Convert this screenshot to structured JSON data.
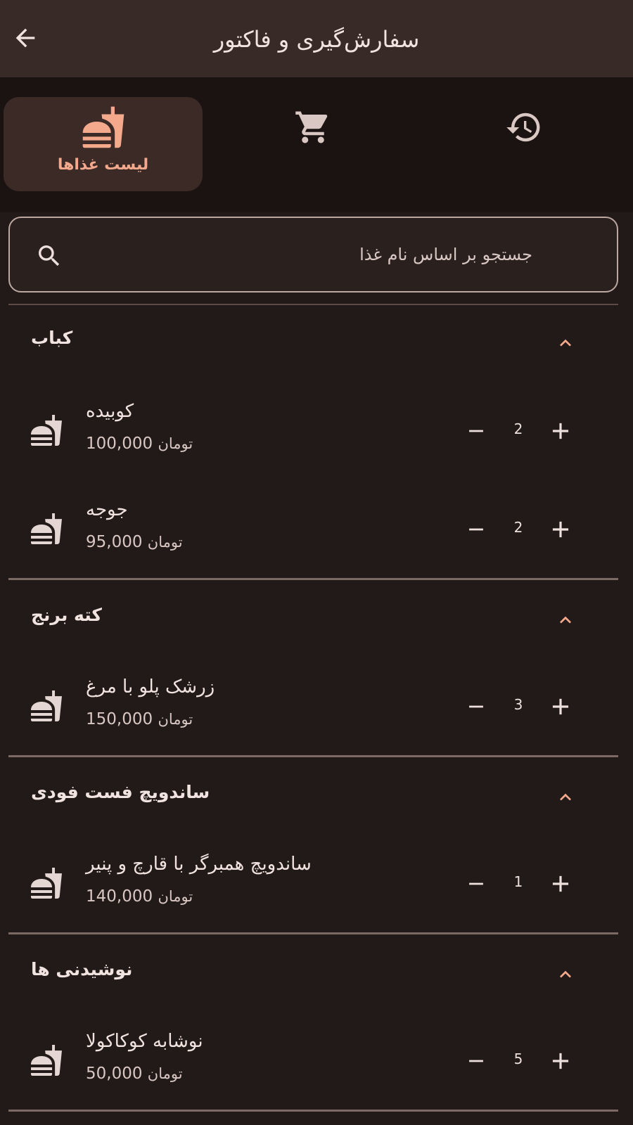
{
  "appbar": {
    "title": "سفارش‌گیری و فاکتور",
    "back_icon": "arrow-back-icon"
  },
  "nav": {
    "items": [
      {
        "label": "لیست غذاها",
        "icon": "fastfood-icon",
        "active": true
      },
      {
        "label": "",
        "icon": "cart-icon",
        "active": false
      },
      {
        "label": "",
        "icon": "history-icon",
        "active": false
      }
    ]
  },
  "search": {
    "placeholder": "جستجو بر اساس نام غذا",
    "value": ""
  },
  "currency": "تومان",
  "colors": {
    "accent": "#f4a98d",
    "background": "#221a18",
    "appbar": "#382a27"
  },
  "sections": [
    {
      "title": "کباب",
      "items": [
        {
          "name": "کوبیده",
          "price": "100,000",
          "qty": "2"
        },
        {
          "name": "جوجه",
          "price": "95,000",
          "qty": "2"
        }
      ]
    },
    {
      "title": "کته برنج",
      "items": [
        {
          "name": "زرشک پلو با مرغ",
          "price": "150,000",
          "qty": "3"
        }
      ]
    },
    {
      "title": "ساندویچ فست فودی",
      "items": [
        {
          "name": "ساندویچ همبرگر با قارچ و پنیر",
          "price": "140,000",
          "qty": "1"
        }
      ]
    },
    {
      "title": "نوشیدنی ها",
      "items": [
        {
          "name": "نوشابه کوکاکولا",
          "price": "50,000",
          "qty": "5"
        }
      ]
    }
  ]
}
